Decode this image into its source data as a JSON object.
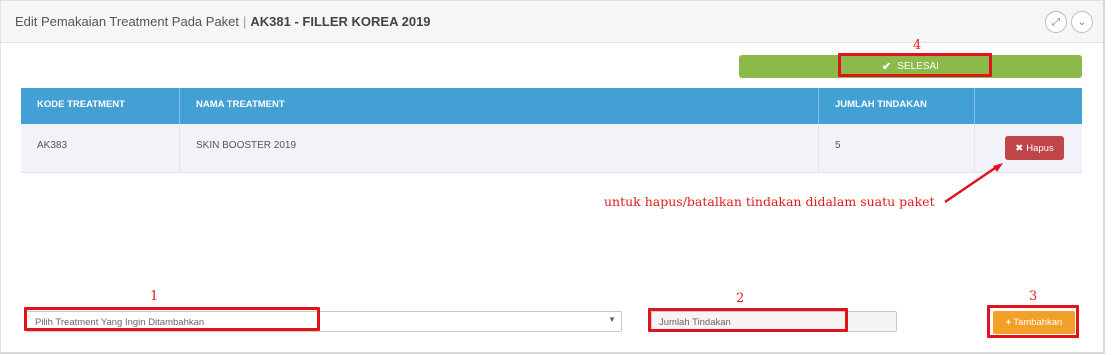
{
  "header": {
    "title": "Edit Pemakaian Treatment Pada Paket",
    "separator": "|",
    "package": "AK381 - FILLER KOREA 2019",
    "expand_icon": "expand-icon",
    "collapse_icon": "chevron-down-icon"
  },
  "toolbar": {
    "selesai_label": "SELESAI",
    "selesai_color": "#8bb94a"
  },
  "table": {
    "headers": [
      "KODE TREATMENT",
      "NAMA TREATMENT",
      "JUMLAH TINDAKAN",
      ""
    ],
    "rows": [
      {
        "kode": "AK383",
        "nama": "SKIN BOOSTER 2019",
        "jumlah": "5",
        "action": "Hapus"
      }
    ],
    "header_color": "#42a0d4"
  },
  "form": {
    "treatment_placeholder": "Pilih Treatment Yang Ingin Ditambahkan",
    "qty_placeholder": "Jumlah Tindakan",
    "add_label": "Tambahkan",
    "add_color": "#f2a028"
  },
  "annotations": {
    "n1": "1",
    "n2": "2",
    "n3": "3",
    "n4": "4",
    "note": "untuk hapus/batalkan tindakan didalam suatu paket",
    "color": "#e0121c"
  }
}
